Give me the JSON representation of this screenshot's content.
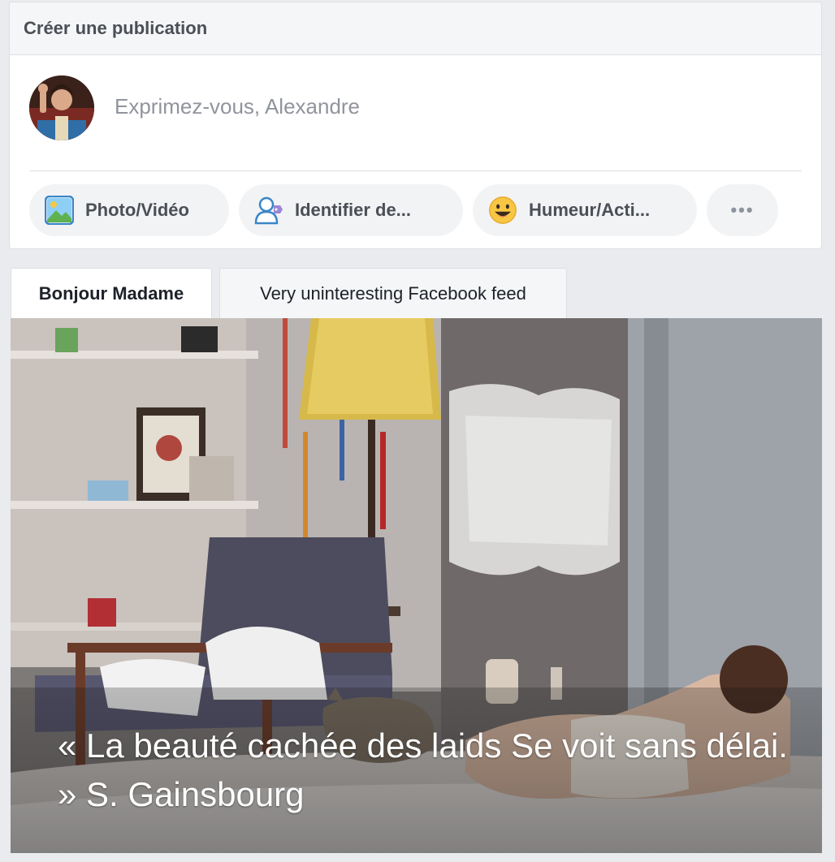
{
  "composer": {
    "title": "Créer une publication",
    "placeholder": "Exprimez-vous, Alexandre",
    "actions": [
      {
        "label": "Photo/Vidéo",
        "icon": "photo-icon"
      },
      {
        "label": "Identifier de...",
        "icon": "tag-people-icon"
      },
      {
        "label": "Humeur/Acti...",
        "icon": "smiley-icon"
      },
      {
        "label": "•••",
        "icon": "more-icon"
      }
    ]
  },
  "tabs": [
    {
      "label": "Bonjour Madame",
      "active": true
    },
    {
      "label": "Very uninteresting Facebook feed",
      "active": false
    }
  ],
  "post": {
    "caption": "« La beauté cachée des laids Se voit sans délai. » S. Gainsbourg"
  },
  "colors": {
    "background": "#e9ebee",
    "card": "#ffffff",
    "header_bg": "#f5f6f7",
    "pill_bg": "#f2f3f5",
    "text_muted": "#90949c",
    "text_dark": "#4b4f56"
  }
}
